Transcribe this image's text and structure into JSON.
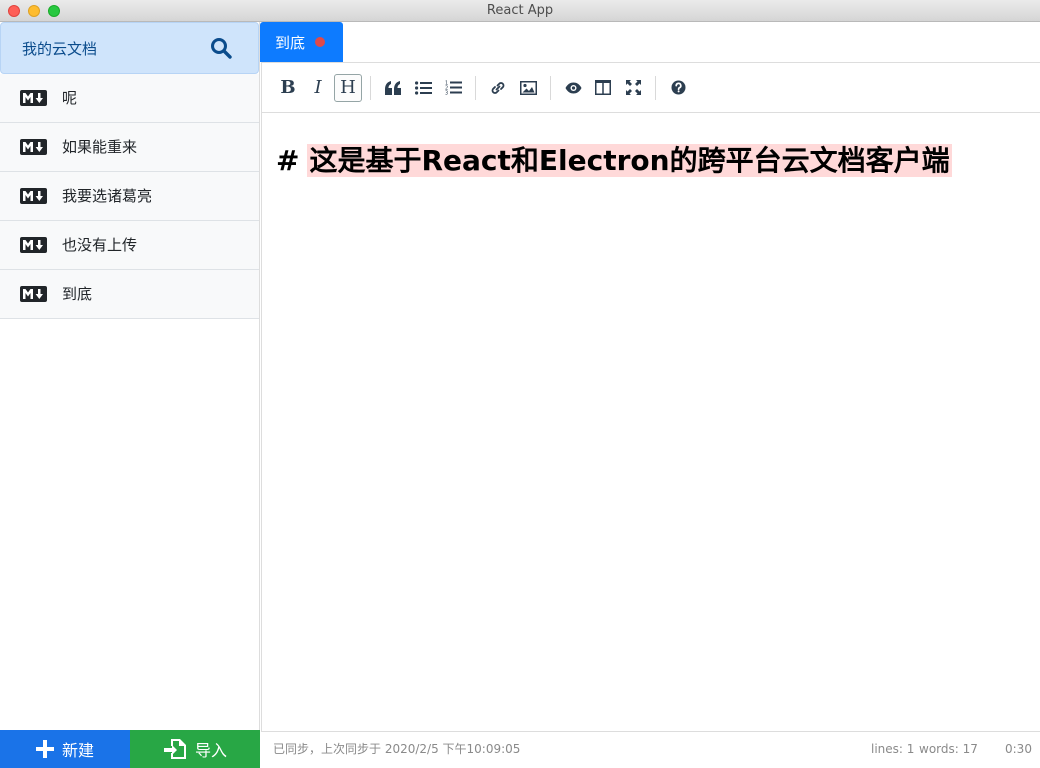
{
  "window": {
    "title": "React App"
  },
  "sidebar": {
    "title": "我的云文档",
    "files": [
      {
        "name": "呢"
      },
      {
        "name": "如果能重来"
      },
      {
        "name": "我要选诸葛亮"
      },
      {
        "name": "也没有上传"
      },
      {
        "name": "到底"
      }
    ],
    "new_button": "新建",
    "import_button": "导入"
  },
  "tabs": [
    {
      "label": "到底",
      "unsaved": true
    }
  ],
  "editor": {
    "hash": "#",
    "heading": "这是基于React和Electron的跨平台云文档客户端"
  },
  "status": {
    "sync": "已同步，上次同步于 2020/2/5 下午10:09:05",
    "lines": "lines: 1",
    "words": "words: 17",
    "time": "0:30"
  },
  "colors": {
    "accent": "#0d7bff",
    "success": "#28a745",
    "search_bg": "#cfe4fb",
    "unsaved": "#e04a4a"
  }
}
